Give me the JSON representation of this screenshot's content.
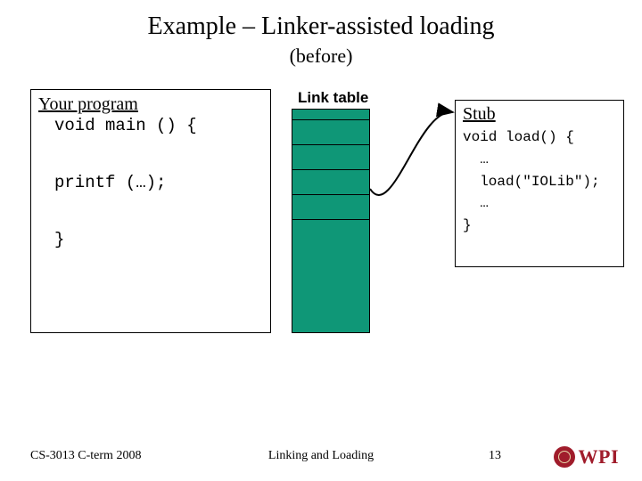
{
  "title": "Example – Linker-assisted loading",
  "subtitle": "(before)",
  "program": {
    "heading": "Your program",
    "line1": "void main () {",
    "line2": "printf (…);",
    "line3": "}"
  },
  "linktable": {
    "label": "Link table"
  },
  "stub": {
    "heading": "Stub",
    "line1": "void load() {",
    "line2": "  …",
    "line3": "  load(\"IOLib\");",
    "line4": "  …",
    "line5": "}"
  },
  "footer": {
    "left": "CS-3013 C-term 2008",
    "center": "Linking and Loading",
    "page": "13",
    "logo_text": "WPI"
  }
}
